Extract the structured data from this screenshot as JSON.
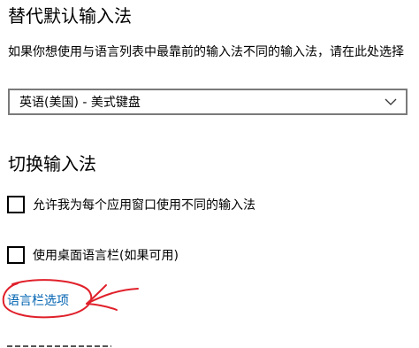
{
  "default_input_method": {
    "title": "替代默认输入法",
    "description": "如果你想使用与语言列表中最靠前的输入法不同的输入法，请在此处选择",
    "selected_value": "英语(美国) - 美式键盘"
  },
  "switch_input_method": {
    "title": "切换输入法",
    "options": [
      {
        "label": "允许我为每个应用窗口使用不同的输入法",
        "checked": false
      },
      {
        "label": "使用桌面语言栏(如果可用)",
        "checked": false
      }
    ],
    "link_label": "语言栏选项"
  },
  "colors": {
    "link": "#0063b1",
    "annotation": "#e0202a",
    "select_border": "#7a7a7a"
  },
  "icons": {
    "dropdown": "chevron-down-icon",
    "annotation": "red-circle-arrow-annotation"
  }
}
